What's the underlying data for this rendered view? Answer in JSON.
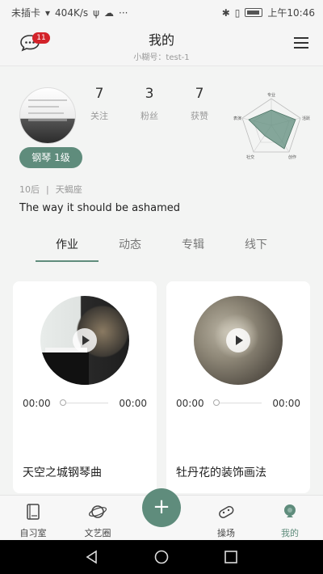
{
  "status_bar": {
    "left_items": [
      "未插卡",
      "404K/s"
    ],
    "time": "上午10:46"
  },
  "header": {
    "title": "我的",
    "subtitle": "小糊号：test-1",
    "message_badge": "11"
  },
  "profile": {
    "level": "钢琴 1级",
    "stats": [
      {
        "value": "7",
        "label": "关注"
      },
      {
        "value": "3",
        "label": "粉丝"
      },
      {
        "value": "7",
        "label": "获赞"
      }
    ],
    "radar_labels": [
      "专业",
      "活跃",
      "创作",
      "社交",
      "表演"
    ],
    "era": "10后",
    "zodiac": "天蝎座",
    "bio": "The way it should be ashamed"
  },
  "tabs": [
    "作业",
    "动态",
    "专辑",
    "线下"
  ],
  "cards": [
    {
      "title": "天空之城钢琴曲",
      "time_start": "00:00",
      "time_end": "00:00",
      "progress": 0
    },
    {
      "title": "牡丹花的装饰画法",
      "time_start": "00:00",
      "time_end": "00:00",
      "progress": 0
    }
  ],
  "bottom_nav": {
    "items": [
      "自习室",
      "文艺圈",
      "操场",
      "我的"
    ],
    "fab": "+"
  },
  "colors": {
    "accent": "#5f8c7c",
    "badge": "#d3232a"
  }
}
